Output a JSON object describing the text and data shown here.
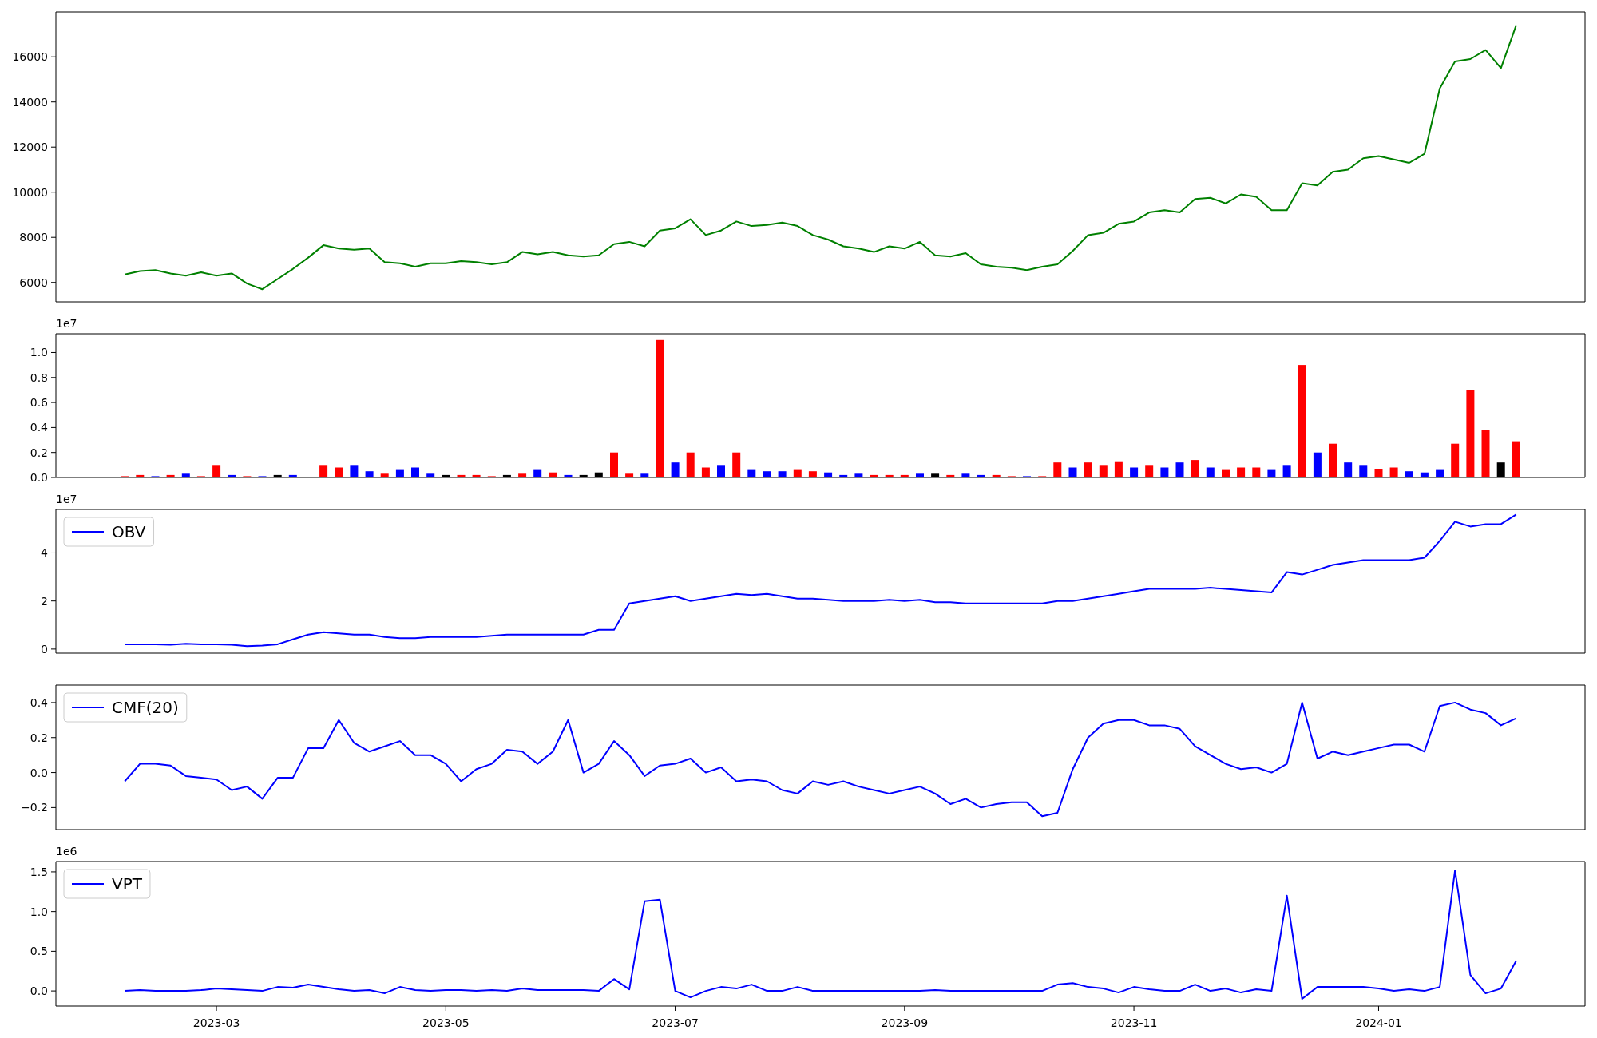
{
  "figure": {
    "panels": [
      {
        "chart_data": {
          "type": "line",
          "ylim": [
            5140,
            17990
          ],
          "yticks": [
            {
              "value": 6000,
              "label": "6000"
            },
            {
              "value": 8000,
              "label": "8000"
            },
            {
              "value": 10000,
              "label": "10000"
            },
            {
              "value": 12000,
              "label": "12000"
            },
            {
              "value": 14000,
              "label": "14000"
            },
            {
              "value": 16000,
              "label": "16000"
            }
          ],
          "categories": [
            null,
            null,
            null,
            null,
            null,
            null,
            null,
            null,
            null,
            null,
            null,
            null,
            null,
            null,
            null,
            null,
            null,
            null,
            null,
            null,
            null,
            null,
            null,
            null,
            null,
            null,
            null,
            null,
            null,
            null,
            null,
            null,
            null,
            null,
            null,
            null,
            null,
            null,
            null,
            null,
            null,
            null,
            null,
            null,
            null,
            null,
            null,
            null,
            null,
            null,
            null,
            null,
            null,
            null,
            null,
            null,
            null,
            null,
            null,
            null,
            null,
            null,
            null,
            null,
            null,
            null,
            null,
            null,
            null,
            null,
            null,
            null,
            null,
            null,
            null,
            null,
            null,
            null,
            null,
            null,
            null,
            null,
            null,
            null,
            null,
            null,
            null,
            null,
            null,
            null,
            null,
            null,
            null,
            null,
            null,
            null,
            null,
            null,
            null,
            null
          ],
          "series": [
            {
              "color": "#008000",
              "values": [
                null,
                null,
                null,
                null,
                6350,
                6500,
                6550,
                6400,
                6300,
                6450,
                6300,
                6400,
                5950,
                5700,
                6150,
                6600,
                7100,
                7650,
                7500,
                7450,
                7500,
                6900,
                6850,
                6700,
                6850,
                6850,
                6950,
                6900,
                6800,
                6900,
                7350,
                7250,
                7350,
                7200,
                7150,
                7200,
                7700,
                7800,
                7600,
                8300,
                8400,
                8800,
                8100,
                8300,
                8700,
                8500,
                8550,
                8650,
                8500,
                8100,
                7900,
                7600,
                7500,
                7350,
                7600,
                7500,
                7800,
                7200,
                7150,
                7300,
                6800,
                6700,
                6650,
                6550,
                6700,
                6800,
                7400,
                8100,
                8200,
                8600,
                8700,
                9100,
                9200,
                9100,
                9700,
                9750,
                9500,
                9900,
                9800,
                9200,
                9200,
                10400,
                10300,
                10900,
                11000,
                11500,
                11600,
                11450,
                11300,
                11700,
                14600,
                15800,
                15900,
                16300,
                15500,
                17400,
                null,
                null,
                null,
                null
              ]
            }
          ]
        }
      },
      {
        "offset_text": "1e7",
        "chart_data": {
          "type": "bar",
          "ylim": [
            0,
            1.15
          ],
          "yticks": [
            {
              "value": 0,
              "label": "0.0"
            },
            {
              "value": 0.2,
              "label": "0.2"
            },
            {
              "value": 0.4,
              "label": "0.4"
            },
            {
              "value": 0.6,
              "label": "0.6"
            },
            {
              "value": 0.8,
              "label": "0.8"
            },
            {
              "value": 1.0,
              "label": "1.0"
            }
          ],
          "categories": [
            null,
            null,
            null,
            null,
            null,
            null,
            null,
            null,
            null,
            null,
            null,
            null,
            null,
            null,
            null,
            null,
            null,
            null,
            null,
            null,
            null,
            null,
            null,
            null,
            null,
            null,
            null,
            null,
            null,
            null,
            null,
            null,
            null,
            null,
            null,
            null,
            null,
            null,
            null,
            null,
            null,
            null,
            null,
            null,
            null,
            null,
            null,
            null,
            null,
            null,
            null,
            null,
            null,
            null,
            null,
            null,
            null,
            null,
            null,
            null,
            null,
            null,
            null,
            null,
            null,
            null,
            null,
            null,
            null,
            null,
            null,
            null,
            null,
            null,
            null,
            null,
            null,
            null,
            null,
            null,
            null,
            null,
            null,
            null,
            null,
            null,
            null,
            null,
            null,
            null,
            null,
            null,
            null,
            null,
            null,
            null,
            null,
            null,
            null,
            null
          ],
          "series": [
            {
              "color": "#ff0000",
              "values": [
                null,
                null,
                null,
                null,
                0.01,
                0.02,
                null,
                0.02,
                null,
                0.01,
                0.1,
                null,
                0.01,
                null,
                null,
                null,
                null,
                0.1,
                0.08,
                null,
                null,
                0.03,
                null,
                null,
                null,
                null,
                0.02,
                0.02,
                0.01,
                null,
                0.03,
                null,
                0.04,
                null,
                null,
                null,
                0.2,
                0.03,
                null,
                1.1,
                null,
                0.2,
                0.08,
                null,
                0.2,
                null,
                null,
                null,
                0.06,
                0.05,
                null,
                null,
                null,
                0.02,
                0.02,
                0.02,
                null,
                null,
                0.02,
                null,
                null,
                0.02,
                0.01,
                null,
                0.01,
                0.12,
                null,
                0.12,
                0.1,
                0.13,
                null,
                0.1,
                null,
                null,
                0.14,
                null,
                0.06,
                0.08,
                0.08,
                null,
                null,
                0.9,
                null,
                0.27,
                null,
                null,
                0.07,
                0.08,
                null,
                null,
                null,
                0.27,
                0.7,
                0.38,
                null,
                0.29,
                null,
                null,
                null,
                null
              ]
            },
            {
              "color": "#0000ff",
              "values": [
                null,
                null,
                null,
                null,
                null,
                null,
                0.01,
                null,
                0.03,
                null,
                null,
                0.02,
                null,
                0.01,
                null,
                0.02,
                null,
                null,
                null,
                0.1,
                0.05,
                null,
                0.06,
                0.08,
                0.03,
                null,
                null,
                null,
                null,
                null,
                null,
                0.06,
                null,
                0.02,
                null,
                null,
                null,
                null,
                0.03,
                null,
                0.12,
                null,
                null,
                0.1,
                null,
                0.06,
                0.05,
                0.05,
                null,
                null,
                0.04,
                0.02,
                0.03,
                null,
                null,
                null,
                0.03,
                null,
                null,
                0.03,
                0.02,
                null,
                null,
                0.01,
                null,
                null,
                0.08,
                null,
                null,
                null,
                0.08,
                null,
                0.08,
                0.12,
                null,
                0.08,
                null,
                null,
                null,
                0.06,
                0.1,
                null,
                0.2,
                null,
                0.12,
                0.1,
                null,
                null,
                0.05,
                0.04,
                0.06,
                null,
                null,
                null,
                null,
                null,
                null,
                null,
                null,
                null
              ]
            },
            {
              "color": "#000000",
              "values": [
                null,
                null,
                null,
                null,
                null,
                null,
                null,
                null,
                null,
                null,
                null,
                null,
                null,
                null,
                0.02,
                null,
                null,
                null,
                null,
                null,
                null,
                null,
                null,
                null,
                null,
                0.02,
                null,
                null,
                null,
                0.02,
                null,
                null,
                null,
                null,
                0.02,
                0.04,
                null,
                null,
                null,
                null,
                null,
                null,
                null,
                null,
                null,
                null,
                null,
                null,
                null,
                null,
                null,
                null,
                null,
                null,
                null,
                null,
                null,
                0.03,
                null,
                null,
                null,
                null,
                null,
                null,
                null,
                null,
                null,
                null,
                null,
                null,
                null,
                null,
                null,
                null,
                null,
                null,
                null,
                null,
                null,
                null,
                null,
                null,
                null,
                null,
                null,
                null,
                null,
                null,
                null,
                null,
                null,
                null,
                null,
                null,
                0.12,
                null,
                null,
                null,
                null,
                null
              ]
            }
          ]
        }
      },
      {
        "offset_text": "1e7",
        "chart_data": {
          "type": "line",
          "ylim": [
            -0.17,
            5.81
          ],
          "yticks": [
            {
              "value": 0,
              "label": "0"
            },
            {
              "value": 2,
              "label": "2"
            },
            {
              "value": 4,
              "label": "4"
            }
          ],
          "categories": [
            null,
            null,
            null,
            null,
            null,
            null,
            null,
            null,
            null,
            null,
            null,
            null,
            null,
            null,
            null,
            null,
            null,
            null,
            null,
            null,
            null,
            null,
            null,
            null,
            null,
            null,
            null,
            null,
            null,
            null,
            null,
            null,
            null,
            null,
            null,
            null,
            null,
            null,
            null,
            null,
            null,
            null,
            null,
            null,
            null,
            null,
            null,
            null,
            null,
            null,
            null,
            null,
            null,
            null,
            null,
            null,
            null,
            null,
            null,
            null,
            null,
            null,
            null,
            null,
            null,
            null,
            null,
            null,
            null,
            null,
            null,
            null,
            null,
            null,
            null,
            null,
            null,
            null,
            null,
            null,
            null,
            null,
            null,
            null,
            null,
            null,
            null,
            null,
            null,
            null,
            null,
            null,
            null,
            null,
            null,
            null,
            null,
            null,
            null,
            null
          ],
          "series": [
            {
              "name": "OBV",
              "color": "#0000ff",
              "values": [
                null,
                null,
                null,
                null,
                0.2,
                0.2,
                0.2,
                0.18,
                0.22,
                0.2,
                0.2,
                0.18,
                0.12,
                0.15,
                0.2,
                0.4,
                0.6,
                0.7,
                0.65,
                0.6,
                0.6,
                0.5,
                0.45,
                0.45,
                0.5,
                0.5,
                0.5,
                0.5,
                0.55,
                0.6,
                0.6,
                0.6,
                0.6,
                0.6,
                0.6,
                0.8,
                0.8,
                1.9,
                2.0,
                2.1,
                2.2,
                2.0,
                2.1,
                2.2,
                2.3,
                2.25,
                2.3,
                2.2,
                2.1,
                2.1,
                2.05,
                2.0,
                2.0,
                2.0,
                2.05,
                2.0,
                2.05,
                1.95,
                1.95,
                1.9,
                1.9,
                1.9,
                1.9,
                1.9,
                1.9,
                2.0,
                2.0,
                2.1,
                2.2,
                2.3,
                2.4,
                2.5,
                2.5,
                2.5,
                2.5,
                2.55,
                2.5,
                2.45,
                2.4,
                2.35,
                3.2,
                3.1,
                3.3,
                3.5,
                3.6,
                3.7,
                3.7,
                3.7,
                3.7,
                3.8,
                4.5,
                5.3,
                5.1,
                5.2,
                5.2,
                5.6,
                null,
                null,
                null,
                null
              ]
            }
          ]
        }
      },
      {
        "chart_data": {
          "type": "line",
          "ylim": [
            -0.326,
            0.5
          ],
          "yticks": [
            {
              "value": -0.2,
              "label": "−0.2"
            },
            {
              "value": 0,
              "label": "0.0"
            },
            {
              "value": 0.2,
              "label": "0.2"
            },
            {
              "value": 0.4,
              "label": "0.4"
            }
          ],
          "categories": [
            null,
            null,
            null,
            null,
            null,
            null,
            null,
            null,
            null,
            null,
            null,
            null,
            null,
            null,
            null,
            null,
            null,
            null,
            null,
            null,
            null,
            null,
            null,
            null,
            null,
            null,
            null,
            null,
            null,
            null,
            null,
            null,
            null,
            null,
            null,
            null,
            null,
            null,
            null,
            null,
            null,
            null,
            null,
            null,
            null,
            null,
            null,
            null,
            null,
            null,
            null,
            null,
            null,
            null,
            null,
            null,
            null,
            null,
            null,
            null,
            null,
            null,
            null,
            null,
            null,
            null,
            null,
            null,
            null,
            null,
            null,
            null,
            null,
            null,
            null,
            null,
            null,
            null,
            null,
            null,
            null,
            null,
            null,
            null,
            null,
            null,
            null,
            null,
            null,
            null,
            null,
            null,
            null,
            null,
            null,
            null,
            null,
            null,
            null,
            null
          ],
          "series": [
            {
              "name": "CMF(20)",
              "color": "#0000ff",
              "values": [
                null,
                null,
                null,
                null,
                -0.05,
                0.05,
                0.05,
                0.04,
                -0.02,
                -0.03,
                -0.04,
                -0.1,
                -0.08,
                -0.15,
                -0.03,
                -0.03,
                0.14,
                0.14,
                0.3,
                0.17,
                0.12,
                0.15,
                0.18,
                0.1,
                0.1,
                0.05,
                -0.05,
                0.02,
                0.05,
                0.13,
                0.12,
                0.05,
                0.12,
                0.3,
                0.0,
                0.05,
                0.18,
                0.1,
                -0.02,
                0.04,
                0.05,
                0.08,
                0.0,
                0.03,
                -0.05,
                -0.04,
                -0.05,
                -0.1,
                -0.12,
                -0.05,
                -0.07,
                -0.05,
                -0.08,
                -0.1,
                -0.12,
                -0.1,
                -0.08,
                -0.12,
                -0.18,
                -0.15,
                -0.2,
                -0.18,
                -0.17,
                -0.17,
                -0.25,
                -0.23,
                0.02,
                0.2,
                0.28,
                0.3,
                0.3,
                0.27,
                0.27,
                0.25,
                0.15,
                0.1,
                0.05,
                0.02,
                0.03,
                0.0,
                0.05,
                0.4,
                0.08,
                0.12,
                0.1,
                0.12,
                0.14,
                0.16,
                0.16,
                0.12,
                0.38,
                0.4,
                0.36,
                0.34,
                0.27,
                0.31,
                null,
                null,
                null,
                null
              ]
            }
          ]
        }
      },
      {
        "offset_text": "1e6",
        "chart_data": {
          "type": "line",
          "ylim": [
            -0.19,
            1.63
          ],
          "yticks": [
            {
              "value": 0,
              "label": "0.0"
            },
            {
              "value": 0.5,
              "label": "0.5"
            },
            {
              "value": 1.0,
              "label": "1.0"
            },
            {
              "value": 1.5,
              "label": "1.5"
            }
          ],
          "categories": [
            null,
            null,
            null,
            null,
            null,
            null,
            null,
            null,
            null,
            null,
            "2023-03",
            null,
            null,
            null,
            null,
            null,
            null,
            null,
            null,
            null,
            null,
            null,
            null,
            null,
            null,
            "2023-05",
            null,
            null,
            null,
            null,
            null,
            null,
            null,
            null,
            null,
            null,
            null,
            null,
            null,
            null,
            "2023-07",
            null,
            null,
            null,
            null,
            null,
            null,
            null,
            null,
            null,
            null,
            null,
            null,
            null,
            null,
            "2023-09",
            null,
            null,
            null,
            null,
            null,
            null,
            null,
            null,
            null,
            null,
            null,
            null,
            null,
            null,
            "2023-11",
            null,
            null,
            null,
            null,
            null,
            null,
            null,
            null,
            null,
            null,
            null,
            null,
            null,
            null,
            null,
            "2024-01",
            null,
            null,
            null,
            null,
            null,
            null,
            null,
            null,
            null,
            null,
            null,
            null,
            null
          ],
          "series": [
            {
              "name": "VPT",
              "color": "#0000ff",
              "values": [
                null,
                null,
                null,
                null,
                0,
                0.01,
                0,
                0,
                0,
                0.01,
                0.03,
                0.02,
                0.01,
                0,
                0.05,
                0.04,
                0.08,
                0.05,
                0.02,
                0.0,
                0.01,
                -0.03,
                0.05,
                0.01,
                0.0,
                0.01,
                0.01,
                0.0,
                0.01,
                0.0,
                0.03,
                0.01,
                0.01,
                0.01,
                0.01,
                0.0,
                0.15,
                0.02,
                1.13,
                1.15,
                0.0,
                -0.08,
                0.0,
                0.05,
                0.03,
                0.08,
                0.0,
                0.0,
                0.05,
                0.0,
                0.0,
                0.0,
                0.0,
                0.0,
                0.0,
                0.0,
                0.0,
                0.01,
                0.0,
                0.0,
                0.0,
                0.0,
                0.0,
                0.0,
                0.0,
                0.08,
                0.1,
                0.05,
                0.03,
                -0.02,
                0.05,
                0.02,
                0.0,
                0.0,
                0.08,
                0.0,
                0.03,
                -0.02,
                0.02,
                0.0,
                1.2,
                -0.1,
                0.05,
                0.05,
                0.05,
                0.05,
                0.03,
                0.0,
                0.02,
                0.0,
                0.05,
                1.52,
                0.2,
                -0.03,
                0.03,
                0.38,
                null,
                null,
                null,
                null
              ]
            }
          ]
        }
      }
    ]
  }
}
